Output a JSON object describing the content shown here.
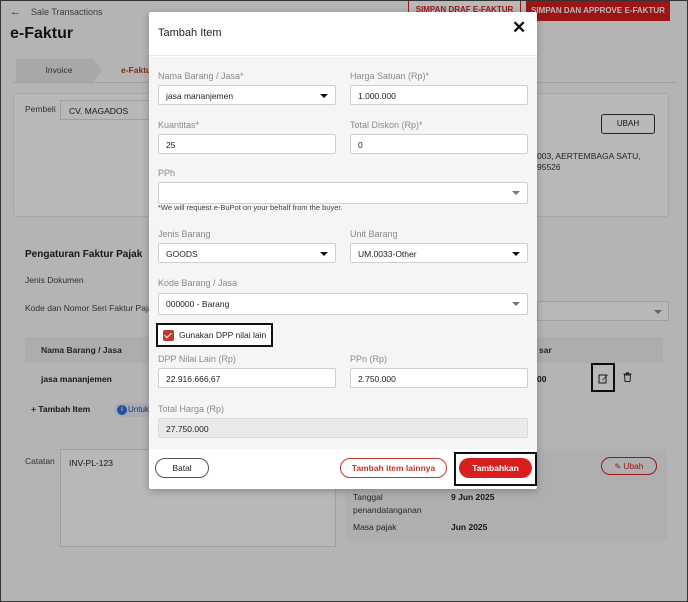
{
  "page": {
    "breadcrumb": "Sale Transactions",
    "title": "e-Faktur",
    "btn_draft": "SIMPAN DRAF E-FAKTUR",
    "btn_approve": "SIMPAN DAN APPROVE E-FAKTUR",
    "tabs": [
      {
        "label": "Invoice"
      },
      {
        "label": "e-Faktur"
      }
    ],
    "pembeli_label": "Pembeli",
    "pembeli_value": "CV. MAGADOS",
    "ubah_label": "UBAH",
    "address_line1": "003, AERTEMBAGA SATU,",
    "address_line2": "95526",
    "settings_title": "Pengaturan Faktur Pajak",
    "jenis_dokumen_label": "Jenis Dokumen",
    "kode_seri_label": "Kode dan Nomor Seri Faktur Pajak",
    "items_header_name": "Nama Barang / Jasa",
    "items_header_right": "sar",
    "item_row_name": "jasa mananjemen",
    "item_row_value": "00",
    "add_item_label": "Tambah Item",
    "info_label": "Untuk",
    "catatan_label": "Catatan",
    "catatan_value": "INV-PL-123",
    "sign_ubah": "Ubah",
    "sign_tanggal_label_1": "Tanggal",
    "sign_tanggal_label_2": "penandatanganan",
    "sign_tanggal_value": "9 Jun 2025",
    "masa_pajak_label": "Masa pajak",
    "masa_pajak_value": "Jun 2025"
  },
  "modal": {
    "title": "Tambah Item",
    "nama_barang": {
      "label": "Nama Barang / Jasa*",
      "value": "jasa mananjemen"
    },
    "harga_satuan": {
      "label": "Harga Satuan (Rp)*",
      "value": "1.000.000"
    },
    "kuantitas": {
      "label": "Kuantitas*",
      "value": "25"
    },
    "total_diskon": {
      "label": "Total Diskon (Rp)*",
      "value": "0"
    },
    "pph": {
      "label": "PPh",
      "value": ""
    },
    "pph_note": "*We will request e-BuPot on your behalf from the buyer.",
    "jenis_barang": {
      "label": "Jenis Barang",
      "value": "GOODS"
    },
    "unit_barang": {
      "label": "Unit Barang",
      "value": "UM.0033-Other"
    },
    "kode_barang": {
      "label": "Kode Barang / Jasa",
      "value": "000000 - Barang"
    },
    "dpp_checkbox_label": "Gunakan DPP nilai lain",
    "dpp_nilai_lain": {
      "label": "DPP Nilai Lain (Rp)",
      "value": "22.916.666,67"
    },
    "ppn": {
      "label": "PPn (Rp)",
      "value": "2.750.000"
    },
    "total_harga": {
      "label": "Total Harga (Rp)",
      "value": "27.750.000"
    },
    "btn_batal": "Batal",
    "btn_tambah_lainnya": "Tambah item lainnya",
    "btn_tambahkan": "Tambahkan"
  }
}
